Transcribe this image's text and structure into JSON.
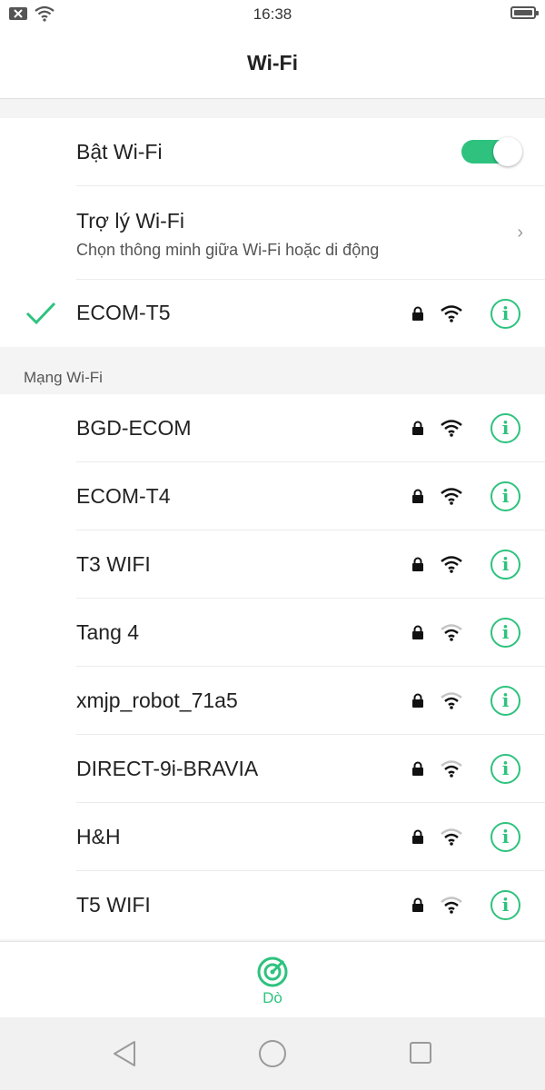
{
  "status_bar": {
    "time": "16:38"
  },
  "header": {
    "title": "Wi-Fi"
  },
  "wifi_toggle": {
    "label": "Bật Wi-Fi",
    "enabled": true
  },
  "assistant": {
    "title": "Trợ lý Wi-Fi",
    "subtitle": "Chọn thông minh giữa Wi-Fi hoặc di động",
    "chevron": "›"
  },
  "connected": {
    "name": "ECOM-T5",
    "locked": true,
    "signal": "full"
  },
  "networks_section": {
    "title": "Mạng Wi-Fi"
  },
  "networks": [
    {
      "name": "BGD-ECOM",
      "locked": true,
      "signal": "full"
    },
    {
      "name": "ECOM-T4",
      "locked": true,
      "signal": "full"
    },
    {
      "name": "T3 WIFI",
      "locked": true,
      "signal": "full"
    },
    {
      "name": "Tang 4",
      "locked": true,
      "signal": "medium"
    },
    {
      "name": "xmjp_robot_71a5",
      "locked": true,
      "signal": "medium"
    },
    {
      "name": "DIRECT-9i-BRAVIA",
      "locked": true,
      "signal": "medium"
    },
    {
      "name": "H&H",
      "locked": true,
      "signal": "medium"
    },
    {
      "name": "T5 WIFI",
      "locked": true,
      "signal": "medium"
    }
  ],
  "info_glyph": "i",
  "scan": {
    "label": "Dò"
  },
  "colors": {
    "accent": "#2ec27e",
    "text": "#222222",
    "background": "#f4f4f4"
  }
}
